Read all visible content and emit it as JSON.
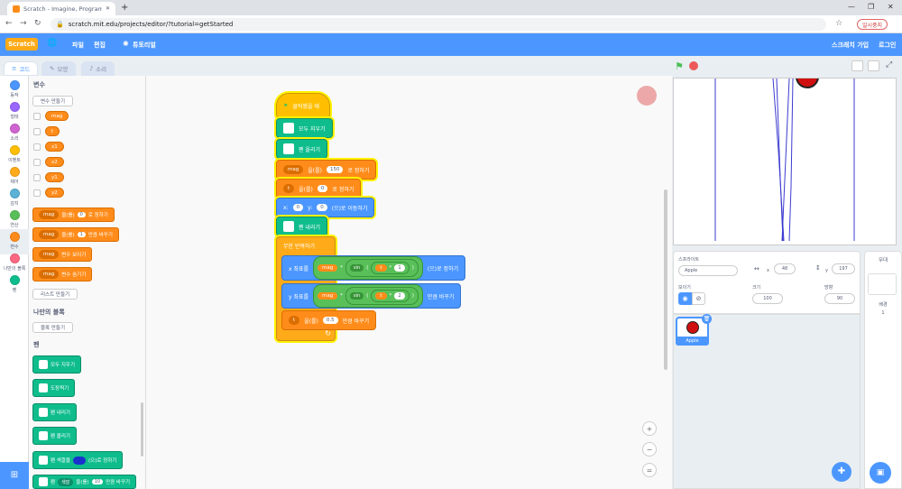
{
  "browser": {
    "tab_title": "Scratch - Imagine, Program, Sh",
    "new_tab": "+",
    "url": "scratch.mit.edu/projects/editor/?tutorial=getStarted",
    "pause_label": "일시중지",
    "win_min": "—",
    "win_max": "❐",
    "win_close": "✕"
  },
  "menubar": {
    "logo": "Scratch",
    "globe": "🌐",
    "file": "파일",
    "edit": "편집",
    "tutorials": "튜토리얼",
    "join": "스크래치 가입",
    "signin": "로그인"
  },
  "tabs": {
    "code": "코드",
    "costumes": "모양",
    "sounds": "소리"
  },
  "categories": [
    {
      "label": "동작",
      "color": "#4c97ff"
    },
    {
      "label": "형태",
      "color": "#9966ff"
    },
    {
      "label": "소리",
      "color": "#cf63cf"
    },
    {
      "label": "이벤트",
      "color": "#ffbf00"
    },
    {
      "label": "제어",
      "color": "#ffab19"
    },
    {
      "label": "감지",
      "color": "#5cb1d6"
    },
    {
      "label": "연산",
      "color": "#59c059"
    },
    {
      "label": "변수",
      "color": "#ff8c1a"
    },
    {
      "label": "나만의 블록",
      "color": "#ff6680"
    },
    {
      "label": "펜",
      "color": "#0fbd8c"
    }
  ],
  "palette": {
    "var_heading": "변수",
    "make_var": "변수 만들기",
    "vars": [
      "mag",
      "t",
      "x1",
      "x2",
      "y1",
      "y2"
    ],
    "set_block": {
      "var": "mag",
      "text": "을(를)",
      "value": "0",
      "suffix": "로 정하기"
    },
    "change_block": {
      "var": "mag",
      "text": "을(를)",
      "value": "1",
      "suffix": "만큼 바꾸기"
    },
    "show_block": {
      "var": "mag",
      "text": "변수 보이기"
    },
    "hide_block": {
      "var": "mag",
      "text": "변수 숨기기"
    },
    "make_list": "리스트 만들기",
    "myblocks_heading": "나만의 블록",
    "make_block": "블록 만들기",
    "pen_heading": "펜",
    "pen_blocks": [
      "모두 지우기",
      "도장찍기",
      "펜 내리기",
      "펜 올리기"
    ],
    "pen_color_block": {
      "prefix": "펜 색깔을",
      "suffix": "(으)로 정하기"
    },
    "pen_change_block": {
      "prefix": "펜",
      "dropdown": "색깔",
      "mid": "을(를)",
      "value": "10",
      "suffix": "만큼 바꾸기"
    }
  },
  "script": {
    "hat": "클릭했을 때",
    "b1": "모두 지우기",
    "b2": "펜 올리기",
    "b3": {
      "var": "mag",
      "text": "을(를)",
      "value": "150",
      "suffix": "로 정하기"
    },
    "b4": {
      "var": "t",
      "text": "을(를)",
      "value": "0",
      "suffix": "로 정하기"
    },
    "b5": {
      "x_label": "x:",
      "x": "0",
      "y_label": "y:",
      "y": "0",
      "suffix": "(으)로 이동하기"
    },
    "b6": "펜 내리기",
    "forever": "무한 반복하기",
    "b7": {
      "prefix": "x 좌표를",
      "var": "mag",
      "times": "*",
      "fn": "sin",
      "open": "(",
      "a": "t",
      "op": "*",
      "b": "1",
      "close": ")",
      "suffix": "(으)로 정하기"
    },
    "b8": {
      "prefix": "y 좌표를",
      "var": "mag",
      "times": "*",
      "fn": "sin",
      "open": "(",
      "a": "t",
      "op": "*",
      "b": "2",
      "close": ")",
      "suffix": "만큼 바꾸기"
    },
    "b9": {
      "var": "t",
      "text": "을(를)",
      "value": "0.5",
      "suffix": "만큼 바꾸기"
    },
    "loop_arrow": "↻"
  },
  "zoom": {
    "in": "+",
    "out": "−",
    "reset": "="
  },
  "sprite_info": {
    "sprite_label": "스프라이트",
    "sprite_name": "Apple",
    "x_label": "x",
    "x_value": "48",
    "y_label": "y",
    "y_value": "197",
    "show_label": "보이기",
    "size_label": "크기",
    "size_value": "100",
    "direction_label": "방향",
    "direction_value": "90"
  },
  "sprites": [
    {
      "name": "Apple"
    }
  ],
  "stage_panel": {
    "title": "무대",
    "backdrop_label": "배경",
    "backdrop_count": "1"
  },
  "colors": {
    "accent": "#4c97ff",
    "pen": "#0fbd8c",
    "variables": "#ff8c1a",
    "events": "#ffbf00",
    "operators": "#59c059"
  }
}
